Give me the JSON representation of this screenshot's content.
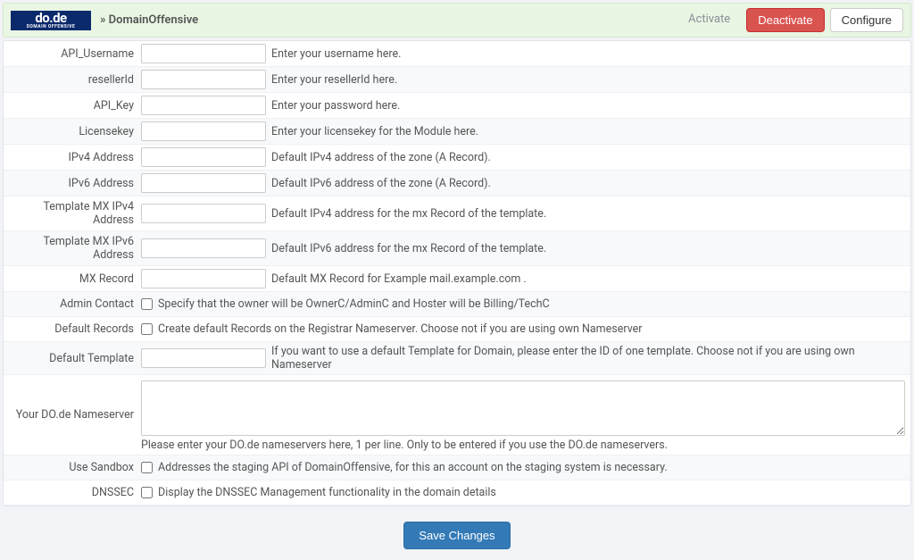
{
  "header": {
    "logo_top": "do.de",
    "logo_bottom": "DOMAIN OFFENSIVE",
    "title": "» DomainOffensive",
    "btn_activate": "Activate",
    "btn_deactivate": "Deactivate",
    "btn_configure": "Configure"
  },
  "fields": {
    "api_username": {
      "label": "API_Username",
      "value": "",
      "hint": "Enter your username here."
    },
    "reseller_id": {
      "label": "resellerId",
      "value": "",
      "hint": "Enter your resellerId here."
    },
    "api_key": {
      "label": "API_Key",
      "value": "",
      "hint": "Enter your password here."
    },
    "licensekey": {
      "label": "Licensekey",
      "value": "",
      "hint": "Enter your licensekey for the Module here."
    },
    "ipv4": {
      "label": "IPv4 Address",
      "value": "",
      "hint": "Default IPv4 address of the zone (A Record)."
    },
    "ipv6": {
      "label": "IPv6 Address",
      "value": "",
      "hint": "Default IPv6 address of the zone (A Record)."
    },
    "tmpl_mx_ipv4": {
      "label": "Template MX IPv4 Address",
      "value": "",
      "hint": "Default IPv4 address for the mx Record of the template."
    },
    "tmpl_mx_ipv6": {
      "label": "Template MX IPv6 Address",
      "value": "",
      "hint": "Default IPv6 address for the mx Record of the template."
    },
    "mx_record": {
      "label": "MX Record",
      "value": "",
      "hint": "Default MX Record for Example mail.example.com ."
    },
    "admin_contact": {
      "label": "Admin Contact",
      "hint": "Specify that the owner will be OwnerC/AdminC and Hoster will be Billing/TechC"
    },
    "default_records": {
      "label": "Default Records",
      "hint": "Create default Records on the Registrar Nameserver. Choose not if you are using own Nameserver"
    },
    "default_template": {
      "label": "Default Template",
      "value": "",
      "hint": "If you want to use a default Template for Domain, please enter the ID of one template. Choose not if you are using own Nameserver"
    },
    "nameserver": {
      "label": "Your DO.de Nameserver",
      "value": "",
      "hint": "Please enter your DO.de nameservers here, 1 per line. Only to be entered if you use the DO.de nameservers."
    },
    "use_sandbox": {
      "label": "Use Sandbox",
      "hint": "Addresses the staging API of DomainOffensive, for this an account on the staging system is necessary."
    },
    "dnssec": {
      "label": "DNSSEC",
      "hint": "Display the DNSSEC Management functionality in the domain details"
    }
  },
  "footer": {
    "save": "Save Changes"
  }
}
